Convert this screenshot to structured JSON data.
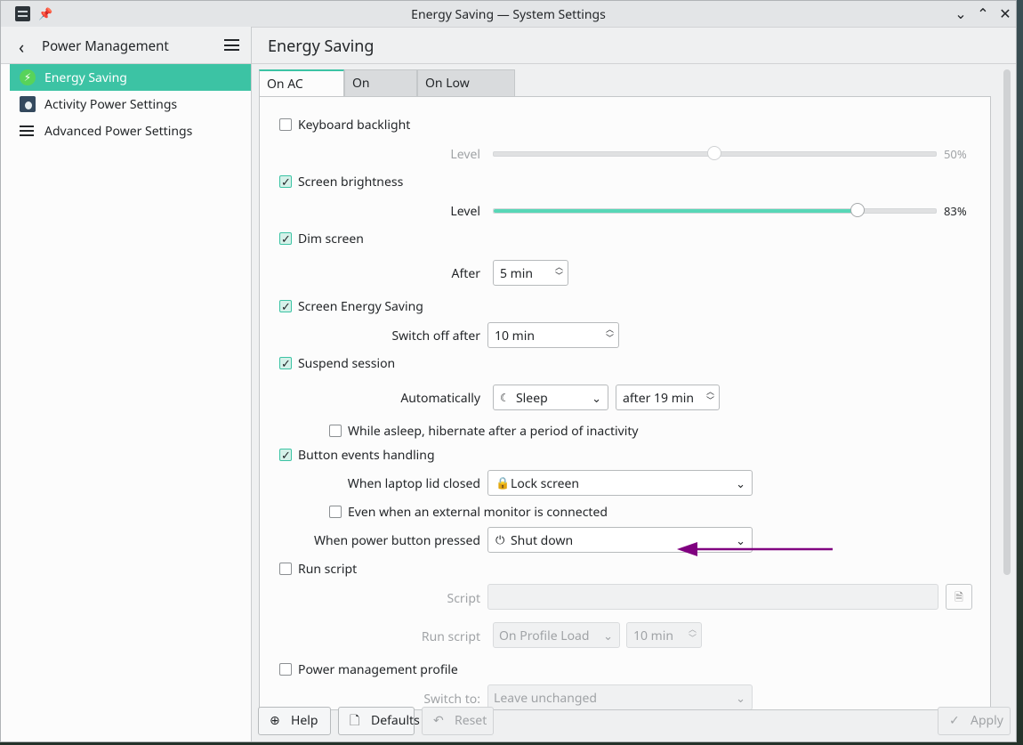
{
  "window": {
    "title": "Energy Saving — System Settings"
  },
  "sidebar": {
    "title": "Power Management",
    "items": [
      {
        "label": "Energy Saving",
        "icon": "lightning-icon",
        "active": true
      },
      {
        "label": "Activity Power Settings",
        "icon": "activity-icon",
        "active": false
      },
      {
        "label": "Advanced Power Settings",
        "icon": "menu-icon",
        "active": false
      }
    ]
  },
  "main": {
    "title": "Energy Saving",
    "tabs": [
      "On AC Power",
      "On Battery",
      "On Low Battery"
    ],
    "active_tab": "On AC Power"
  },
  "settings": {
    "keyboard_backlight": {
      "label": "Keyboard backlight",
      "checked": false,
      "level_label": "Level",
      "level_value": "50%",
      "level": 0.5
    },
    "screen_brightness": {
      "label": "Screen brightness",
      "checked": true,
      "level_label": "Level",
      "level_value": "83%",
      "level": 0.83
    },
    "dim_screen": {
      "label": "Dim screen",
      "checked": true,
      "after_label": "After",
      "after_value": "5 min"
    },
    "screen_energy_saving": {
      "label": "Screen Energy Saving",
      "checked": true,
      "switch_off_label": "Switch off after",
      "switch_off_value": "10 min"
    },
    "suspend_session": {
      "label": "Suspend session",
      "checked": true,
      "automatically_label": "Automatically",
      "action": "Sleep",
      "after_value": "after 19 min",
      "hibernate_label": "While asleep, hibernate after a period of inactivity",
      "hibernate_checked": false
    },
    "button_events": {
      "label": "Button events handling",
      "checked": true,
      "lid_label": "When laptop lid closed",
      "lid_value": "Lock screen",
      "external_monitor_label": "Even when an external monitor is connected",
      "external_monitor_checked": false,
      "power_button_label": "When power button pressed",
      "power_button_value": "Shut down"
    },
    "run_script": {
      "label": "Run script",
      "checked": false,
      "script_label": "Script",
      "script_value": "",
      "run_label": "Run script",
      "run_value": "On Profile Load",
      "run_time": "10 min"
    },
    "power_profile": {
      "label": "Power management profile",
      "checked": false,
      "switch_label": "Switch to:",
      "switch_value": "Leave unchanged"
    }
  },
  "footer": {
    "help": "Help",
    "defaults": "Defaults",
    "reset": "Reset",
    "apply": "Apply"
  },
  "colors": {
    "accent": "#3cc3a4",
    "annotation_arrow": "#800080"
  }
}
